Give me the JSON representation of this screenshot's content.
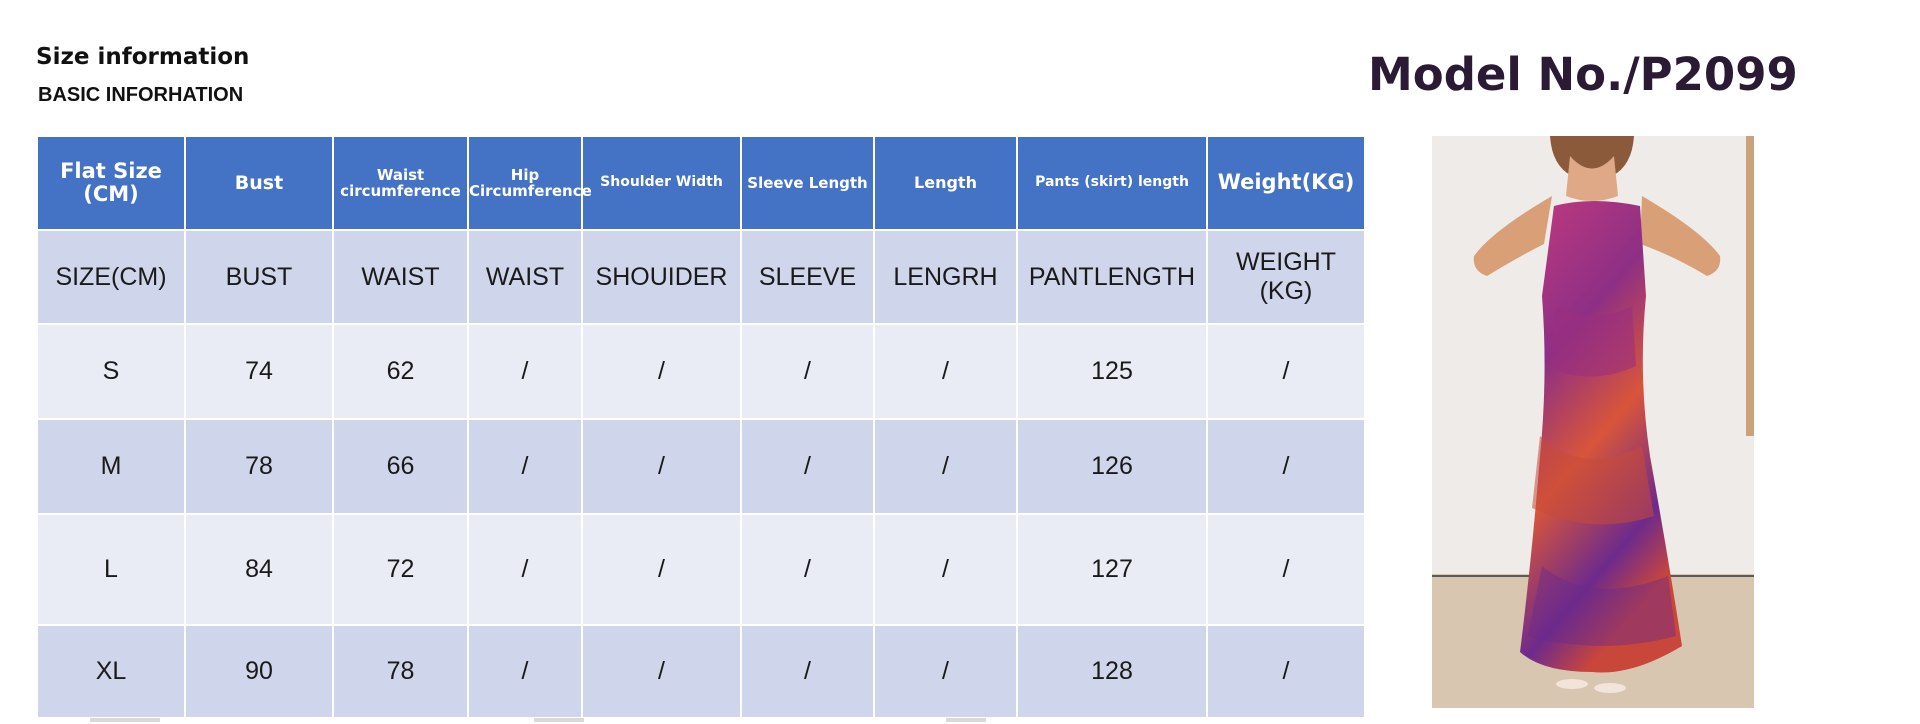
{
  "header": {
    "title": "Size information",
    "subtitle": "BASIC INFORHATION",
    "model": "Model No./P2099"
  },
  "table": {
    "headers": [
      "Flat Size (CM)",
      "Bust",
      "Waist circumference",
      "Hip Circumference",
      "Shoulder Width",
      "Sleeve Length",
      "Length",
      "Pants (skirt) length",
      "Weight(KG)"
    ],
    "subheaders": [
      "SIZE(CM)",
      "BUST",
      "WAIST",
      "WAIST",
      "SHOUIDER",
      "SLEEVE",
      "LENGRH",
      "PANTLENGTH",
      "WEIGHT (KG)"
    ],
    "rows": [
      [
        "S",
        "74",
        "62",
        "/",
        "/",
        "/",
        "/",
        "125",
        "/"
      ],
      [
        "M",
        "78",
        "66",
        "/",
        "/",
        "/",
        "/",
        "126",
        "/"
      ],
      [
        "L",
        "84",
        "72",
        "/",
        "/",
        "/",
        "/",
        "127",
        "/"
      ],
      [
        "XL",
        "90",
        "78",
        "/",
        "/",
        "/",
        "/",
        "128",
        "/"
      ]
    ]
  },
  "colors": {
    "header_bg": "#4472c4",
    "row_dark": "#cfd5ea",
    "row_light": "#e9ebf5",
    "dress_pink": "#c23a7e",
    "dress_orange": "#d8553a",
    "dress_purple": "#6d2a8c"
  }
}
